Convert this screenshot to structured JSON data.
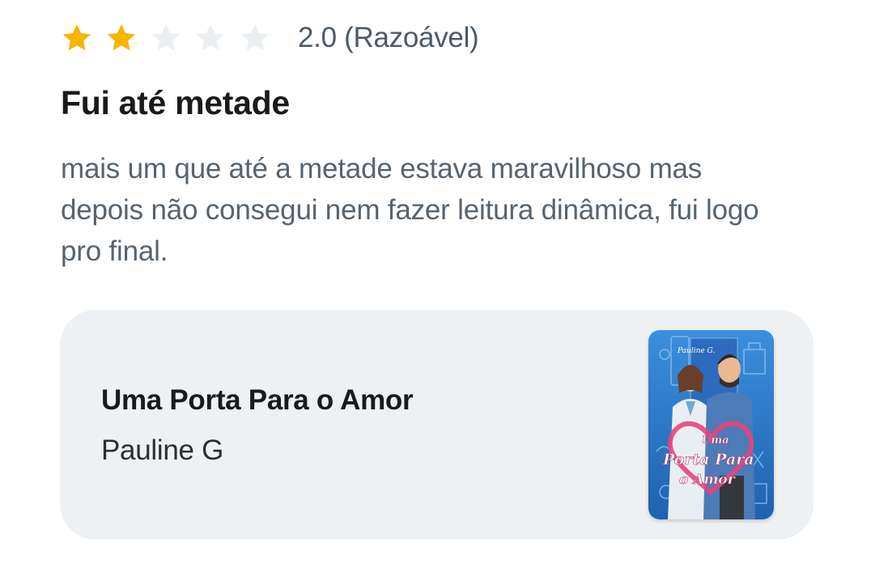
{
  "review": {
    "rating": 2.0,
    "max_rating": 5,
    "rating_label": "2.0 (Razoável)",
    "title": "Fui até metade",
    "body": "mais um que até a metade estava maravilhoso mas depois não consegui nem fazer leitura dinâmica, fui logo pro final."
  },
  "book": {
    "title": "Uma Porta Para o Amor",
    "author": "Pauline G",
    "cover": {
      "author_mark": "Pauline G.",
      "title_line1": "Uma",
      "title_line2": "Porta Para",
      "title_line3": "o Amor"
    }
  },
  "colors": {
    "star_filled": "#f7b500",
    "star_empty": "#eceff1",
    "card_background": "#eef1f3",
    "cover_blue": "#2f7fcf",
    "cover_heart": "#e8447a"
  }
}
